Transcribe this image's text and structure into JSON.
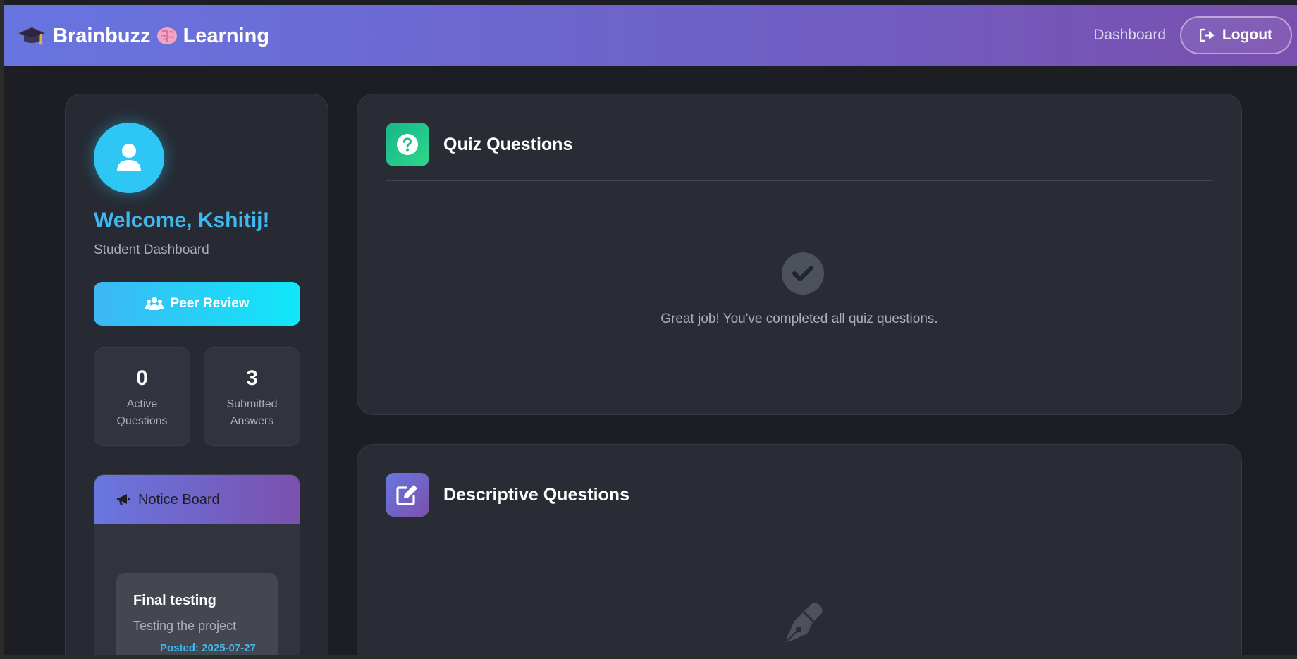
{
  "brand": {
    "name": "Brainbuzz",
    "suffix": "Learning",
    "cap_icon": "graduation-cap-icon",
    "brain_icon": "brain-icon"
  },
  "nav": {
    "dashboard_label": "Dashboard",
    "logout_label": "Logout",
    "logout_icon": "sign-out-icon"
  },
  "sidebar": {
    "welcome": "Welcome, Kshitij!",
    "role": "Student Dashboard",
    "peer_review_label": "Peer Review",
    "stats": [
      {
        "value": "0",
        "label": "Active Questions"
      },
      {
        "value": "3",
        "label": "Submitted Answers"
      }
    ],
    "notice": {
      "title": "Notice Board",
      "items": [
        {
          "title": "Final testing",
          "body": "Testing the project",
          "date": "Posted: 2025-07-27"
        }
      ]
    }
  },
  "quiz": {
    "title": "Quiz Questions",
    "empty_message": "Great job! You've completed all quiz questions."
  },
  "descriptive": {
    "title": "Descriptive Questions"
  },
  "colors": {
    "accent": "#3fb8f0",
    "nav_start": "#6875e0",
    "nav_end": "#7a4fae",
    "card_bg": "#2a2c35",
    "page_bg": "#1c1e24"
  }
}
